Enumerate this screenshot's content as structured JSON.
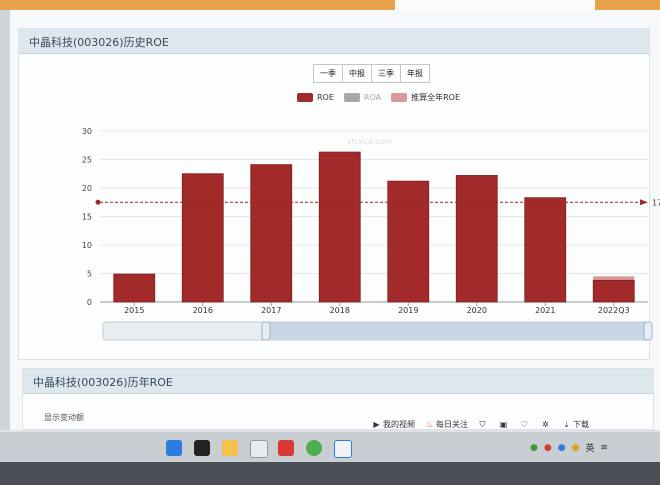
{
  "card1": {
    "title": "中晶科技(003026)历史ROE"
  },
  "card2": {
    "title": "中晶科技(003026)历年ROE",
    "partial_text": "显示变动额"
  },
  "period_tabs": [
    "一季",
    "中报",
    "三季",
    "年报"
  ],
  "legend": [
    {
      "label": "ROE",
      "color": "#a32a2a"
    },
    {
      "label": "ROA",
      "color": "#a9a9a9"
    },
    {
      "label": "推算全年ROE",
      "color": "#d9999a"
    }
  ],
  "chart_data": {
    "type": "bar",
    "categories": [
      "2015",
      "2016",
      "2017",
      "2018",
      "2019",
      "2020",
      "2021",
      "2022Q3"
    ],
    "series": [
      {
        "name": "ROE",
        "values": [
          4.9,
          22.5,
          24.1,
          26.3,
          21.2,
          22.2,
          18.3,
          3.8
        ]
      },
      {
        "name": "推算全年ROE",
        "values": [
          null,
          null,
          null,
          null,
          null,
          null,
          null,
          4.5
        ]
      }
    ],
    "reference_line": {
      "value": 17.5,
      "label": "17"
    },
    "yticks": [
      0,
      5,
      10,
      15,
      20,
      25,
      30
    ],
    "ylim": [
      0,
      30
    ],
    "watermark": "choice.com",
    "grid": true,
    "colors": {
      "bar": "#a32a2a",
      "bar_edge": "#7e1d1d",
      "extrapolated": "#d9999a",
      "reference": "#9a2a2a"
    }
  },
  "toolbar": {
    "items": [
      {
        "label": "我的视频",
        "icon": "play-icon"
      },
      {
        "label": "每日关注",
        "icon": "flame-icon"
      },
      {
        "label": "",
        "icon": "shield-icon"
      },
      {
        "label": "",
        "icon": "image-icon"
      },
      {
        "label": "",
        "icon": "heart-icon"
      },
      {
        "label": "",
        "icon": "settings-icon"
      },
      {
        "label": "下载",
        "icon": "download-icon"
      }
    ]
  },
  "taskbar": {
    "tray_lang": "英"
  }
}
